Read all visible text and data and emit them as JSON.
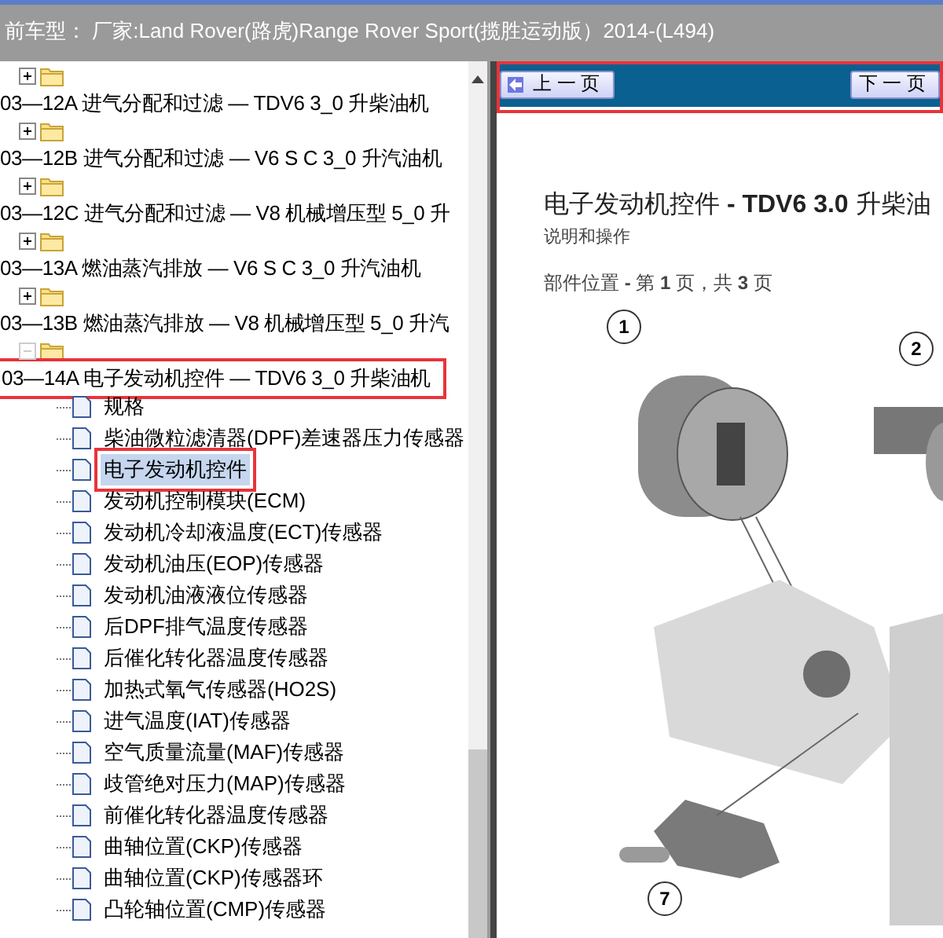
{
  "title_bar": {
    "text": "前车型：  厂家:Land Rover(路虎)Range Rover Sport(揽胜运动版）2014-(L494)"
  },
  "tree": {
    "nodes": [
      {
        "label": "03—12A 进气分配和过滤 — TDV6 3_0 升柴油机",
        "expanded": false,
        "highlighted": false
      },
      {
        "label": "03—12B 进气分配和过滤 — V6 S C 3_0 升汽油机",
        "expanded": false,
        "highlighted": false
      },
      {
        "label": "03—12C 进气分配和过滤 — V8 机械增压型 5_0 升",
        "expanded": false,
        "highlighted": false
      },
      {
        "label": "03—13A 燃油蒸汽排放 — V6 S C 3_0 升汽油机",
        "expanded": false,
        "highlighted": false
      },
      {
        "label": "03—13B 燃油蒸汽排放 — V8 机械增压型 5_0 升汽",
        "expanded": false,
        "highlighted": false
      },
      {
        "label": "03—14A 电子发动机控件 — TDV6 3_0 升柴油机",
        "expanded": true,
        "highlighted": true,
        "children": [
          {
            "label": "规格",
            "selected": false
          },
          {
            "label": "柴油微粒滤清器(DPF)差速器压力传感器",
            "selected": false
          },
          {
            "label": "电子发动机控件",
            "selected": true
          },
          {
            "label": "发动机控制模块(ECM)",
            "selected": false
          },
          {
            "label": "发动机冷却液温度(ECT)传感器",
            "selected": false
          },
          {
            "label": "发动机油压(EOP)传感器",
            "selected": false
          },
          {
            "label": "发动机油液液位传感器",
            "selected": false
          },
          {
            "label": "后DPF排气温度传感器",
            "selected": false
          },
          {
            "label": "后催化转化器温度传感器",
            "selected": false
          },
          {
            "label": "加热式氧气传感器(HO2S)",
            "selected": false
          },
          {
            "label": "进气温度(IAT)传感器",
            "selected": false
          },
          {
            "label": "空气质量流量(MAF)传感器",
            "selected": false
          },
          {
            "label": "歧管绝对压力(MAP)传感器",
            "selected": false
          },
          {
            "label": "前催化转化器温度传感器",
            "selected": false
          },
          {
            "label": "曲轴位置(CKP)传感器",
            "selected": false
          },
          {
            "label": "曲轴位置(CKP)传感器环",
            "selected": false
          },
          {
            "label": "凸轮轴位置(CMP)传感器",
            "selected": false
          }
        ]
      }
    ]
  },
  "viewer": {
    "highlighted": true,
    "buttons": [
      {
        "label": "上 一 页",
        "kind": "prev"
      },
      {
        "label": "下 一 页",
        "kind": "next"
      }
    ],
    "document": {
      "title": "电子发动机控件 **- TDV6 3.0** 升柴油",
      "subtitle": "说明和操作",
      "page_info": "部件位置 **-** 第 **1** 页，共 **3** 页",
      "callouts": [
        {
          "label": "1",
          "kind": "a"
        },
        {
          "label": "2",
          "kind": "b"
        },
        {
          "label": "7",
          "kind": "c"
        }
      ]
    }
  }
}
